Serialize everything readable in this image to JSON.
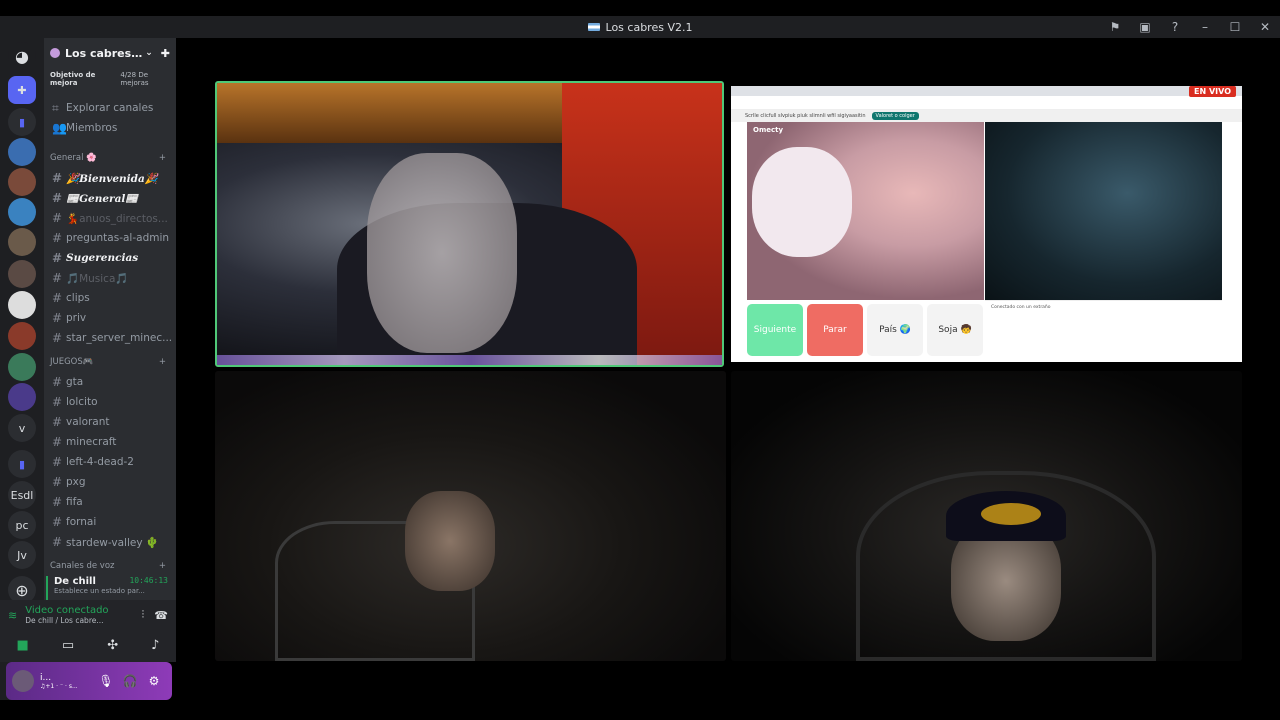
{
  "window": {
    "title": "Los cabres V2.1"
  },
  "server": {
    "name": "Los cabres…",
    "boost_goal": "Objetivo de mejora",
    "boost_count": "4/28 De mejoras"
  },
  "nav": {
    "explore": "Explorar canales",
    "members": "Miembros"
  },
  "categories": {
    "general": "General 🌸",
    "juegos": "JUEGOS🎮",
    "voz": "Canales de voz"
  },
  "channels": {
    "bienvenida": "🎉𝑩𝒊𝒆𝒏𝒗𝒆𝒏𝒊𝒅𝒂🎉",
    "general": "📰𝑮𝒆𝒏𝒆𝒓𝒂𝒍📰",
    "anuncios": "💃anuos_directos...",
    "preguntas": "preguntas-al-admin",
    "sugerencias": "𝑺𝒖𝒈𝒆𝒓𝒆𝒏𝒄𝒊𝒂𝒔",
    "musica": "🎵Musica🎵",
    "clips": "clips",
    "priv": "priv",
    "star": "star_server_minec...",
    "gta": "gta",
    "lolcito": "lolcito",
    "valorant": "valorant",
    "minecraft": "minecraft",
    "l4d2": "left-4-dead-2",
    "pxg": "pxg",
    "fifa": "fifa",
    "fornai": "fornai",
    "stardew": "stardew-valley 🌵"
  },
  "voice_channel": {
    "name": "De chill",
    "time": "10:46:13",
    "status": "Establece un estado par..."
  },
  "voice_panel": {
    "status": "Video conectado",
    "channel": "De chill / Los cabre..."
  },
  "user": {
    "name": "i...",
    "sub": "♫+1 · ⁻ · s..."
  },
  "rail": {
    "esdl": "Esdl",
    "pc": "pc",
    "jv": "Jv",
    "v": "v"
  },
  "stream": {
    "live_badge": "EN VIVO",
    "banner_text": "Scrlle clicfull slvpiuk piuk slimnli wfil sigiyaasitin",
    "banner_button": "Valoret o colger",
    "logo": "Omecty",
    "buttons": {
      "next": "Siguiente",
      "stop": "Parar",
      "country": "País 🌍",
      "gender": "Soja 🧒"
    },
    "chat_text": "Conectado con un extraño"
  },
  "colors": {
    "speaking": "#50c878",
    "voice_green": "#23a55a",
    "live_red": "#d92d20"
  }
}
